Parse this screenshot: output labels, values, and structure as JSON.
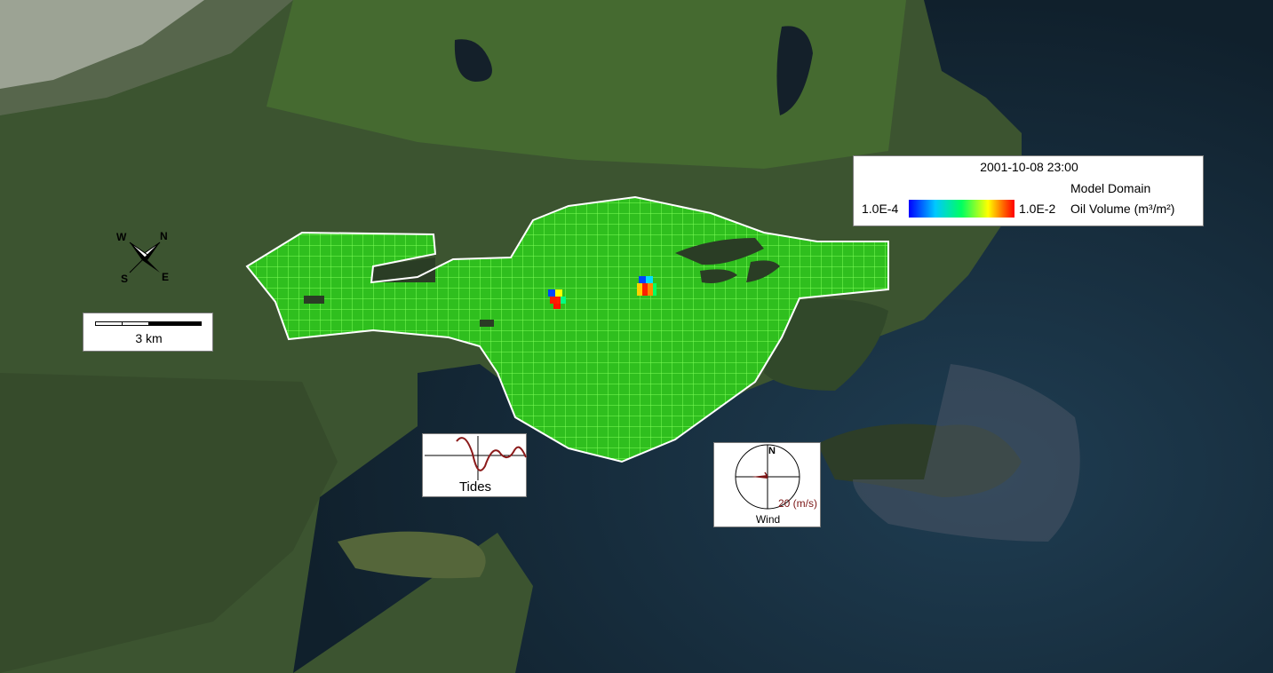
{
  "colors": {
    "land": "#3f5a2c",
    "water": "#14283a",
    "grid_fill": "#2fbf1e",
    "grid_line": "#7dff58",
    "domain_outline": "#ffffff",
    "oil_high": "#ff1a00"
  },
  "legend": {
    "timestamp": "2001-10-08 23:00",
    "min_label": "1.0E-4",
    "max_label": "1.0E-2",
    "domain_label": "Model Domain",
    "variable_label": "Oil Volume (m³/m²)"
  },
  "scalebar": {
    "label": "3 km"
  },
  "compass": {
    "n": "N",
    "e": "E",
    "s": "S",
    "w": "W"
  },
  "tides": {
    "label": "Tides"
  },
  "wind": {
    "north": "N",
    "speed": "20 (m/s)",
    "label": "Wind"
  }
}
